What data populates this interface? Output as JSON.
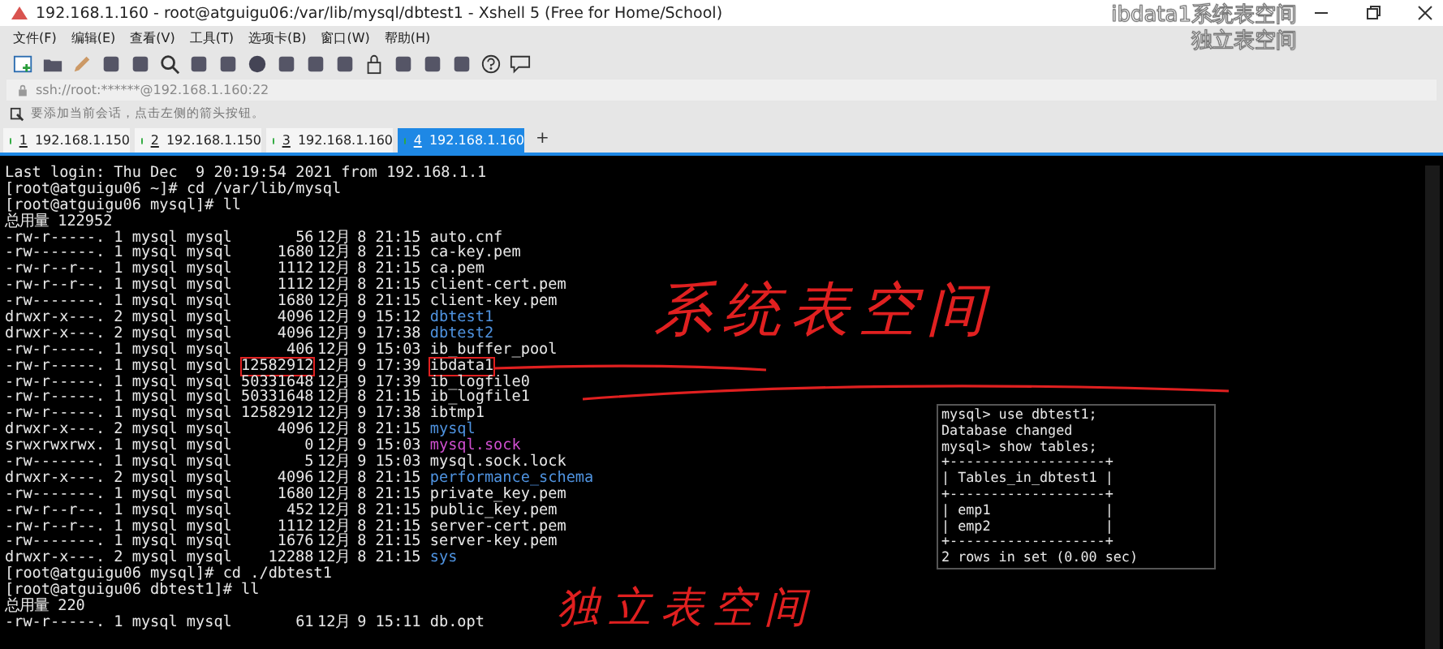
{
  "window": {
    "title": "192.168.1.160 - root@atguigu06:/var/lib/mysql/dbtest1 - Xshell 5 (Free for Home/School)"
  },
  "menu": [
    "文件(F)",
    "编辑(E)",
    "查看(V)",
    "工具(T)",
    "选项卡(B)",
    "窗口(W)",
    "帮助(H)"
  ],
  "address_bar": {
    "value": "ssh://root:******@192.168.1.160:22"
  },
  "info_bar": {
    "text": "要添加当前会话，点击左侧的箭头按钮。"
  },
  "tabs": [
    {
      "number": "1",
      "label": "192.168.1.150",
      "selected": false
    },
    {
      "number": "2",
      "label": "192.168.1.150",
      "selected": false
    },
    {
      "number": "3",
      "label": "192.168.1.160",
      "selected": false
    },
    {
      "number": "4",
      "label": "192.168.1.160",
      "selected": true
    }
  ],
  "add_tab": "+",
  "caption": [
    "ibdata1系统表空间",
    "独立表空间"
  ],
  "terminal": {
    "lines": [
      {
        "kind": "text",
        "text": "Last login: Thu Dec  9 20:19:54 2021 from 192.168.1.1"
      },
      {
        "kind": "text",
        "text": "[root@atguigu06 ~]# cd /var/lib/mysql"
      },
      {
        "kind": "text",
        "text": "[root@atguigu06 mysql]# ll"
      },
      {
        "kind": "text",
        "text": "总用量 122952"
      },
      {
        "kind": "entry",
        "perms": "-rw-r-----.",
        "links": "1",
        "owner": "mysql",
        "group": "mysql",
        "size": "56",
        "month": "12月",
        "day": "8",
        "time": "21:15",
        "name": "auto.cnf",
        "color": "#e8e8e8",
        "boxed": false
      },
      {
        "kind": "entry",
        "perms": "-rw-------.",
        "links": "1",
        "owner": "mysql",
        "group": "mysql",
        "size": "1680",
        "month": "12月",
        "day": "8",
        "time": "21:15",
        "name": "ca-key.pem",
        "color": "#e8e8e8",
        "boxed": false
      },
      {
        "kind": "entry",
        "perms": "-rw-r--r--.",
        "links": "1",
        "owner": "mysql",
        "group": "mysql",
        "size": "1112",
        "month": "12月",
        "day": "8",
        "time": "21:15",
        "name": "ca.pem",
        "color": "#e8e8e8",
        "boxed": false
      },
      {
        "kind": "entry",
        "perms": "-rw-r--r--.",
        "links": "1",
        "owner": "mysql",
        "group": "mysql",
        "size": "1112",
        "month": "12月",
        "day": "8",
        "time": "21:15",
        "name": "client-cert.pem",
        "color": "#e8e8e8",
        "boxed": false
      },
      {
        "kind": "entry",
        "perms": "-rw-------.",
        "links": "1",
        "owner": "mysql",
        "group": "mysql",
        "size": "1680",
        "month": "12月",
        "day": "8",
        "time": "21:15",
        "name": "client-key.pem",
        "color": "#e8e8e8",
        "boxed": false
      },
      {
        "kind": "entry",
        "perms": "drwxr-x---.",
        "links": "2",
        "owner": "mysql",
        "group": "mysql",
        "size": "4096",
        "month": "12月",
        "day": "9",
        "time": "15:12",
        "name": "dbtest1",
        "color": "#4f93e0",
        "boxed": false
      },
      {
        "kind": "entry",
        "perms": "drwxr-x---.",
        "links": "2",
        "owner": "mysql",
        "group": "mysql",
        "size": "4096",
        "month": "12月",
        "day": "9",
        "time": "17:38",
        "name": "dbtest2",
        "color": "#4f93e0",
        "boxed": false
      },
      {
        "kind": "entry",
        "perms": "-rw-r-----.",
        "links": "1",
        "owner": "mysql",
        "group": "mysql",
        "size": "406",
        "month": "12月",
        "day": "9",
        "time": "15:03",
        "name": "ib_buffer_pool",
        "color": "#e8e8e8",
        "boxed": false
      },
      {
        "kind": "entry",
        "perms": "-rw-r-----.",
        "links": "1",
        "owner": "mysql",
        "group": "mysql",
        "size": "12582912",
        "month": "12月",
        "day": "9",
        "time": "17:39",
        "name": "ibdata1",
        "color": "#e8e8e8",
        "boxed": true
      },
      {
        "kind": "entry",
        "perms": "-rw-r-----.",
        "links": "1",
        "owner": "mysql",
        "group": "mysql",
        "size": "50331648",
        "month": "12月",
        "day": "9",
        "time": "17:39",
        "name": "ib_logfile0",
        "color": "#e8e8e8",
        "boxed": false
      },
      {
        "kind": "entry",
        "perms": "-rw-r-----.",
        "links": "1",
        "owner": "mysql",
        "group": "mysql",
        "size": "50331648",
        "month": "12月",
        "day": "8",
        "time": "21:15",
        "name": "ib_logfile1",
        "color": "#e8e8e8",
        "boxed": false
      },
      {
        "kind": "entry",
        "perms": "-rw-r-----.",
        "links": "1",
        "owner": "mysql",
        "group": "mysql",
        "size": "12582912",
        "month": "12月",
        "day": "9",
        "time": "17:38",
        "name": "ibtmp1",
        "color": "#e8e8e8",
        "boxed": false
      },
      {
        "kind": "entry",
        "perms": "drwxr-x---.",
        "links": "2",
        "owner": "mysql",
        "group": "mysql",
        "size": "4096",
        "month": "12月",
        "day": "8",
        "time": "21:15",
        "name": "mysql",
        "color": "#4f93e0",
        "boxed": false
      },
      {
        "kind": "entry",
        "perms": "srwxrwxrwx.",
        "links": "1",
        "owner": "mysql",
        "group": "mysql",
        "size": "0",
        "month": "12月",
        "day": "9",
        "time": "15:03",
        "name": "mysql.sock",
        "color": "#d04fd0",
        "boxed": false
      },
      {
        "kind": "entry",
        "perms": "-rw-------.",
        "links": "1",
        "owner": "mysql",
        "group": "mysql",
        "size": "5",
        "month": "12月",
        "day": "9",
        "time": "15:03",
        "name": "mysql.sock.lock",
        "color": "#e8e8e8",
        "boxed": false
      },
      {
        "kind": "entry",
        "perms": "drwxr-x---.",
        "links": "2",
        "owner": "mysql",
        "group": "mysql",
        "size": "4096",
        "month": "12月",
        "day": "8",
        "time": "21:15",
        "name": "performance_schema",
        "color": "#4f93e0",
        "boxed": false
      },
      {
        "kind": "entry",
        "perms": "-rw-------.",
        "links": "1",
        "owner": "mysql",
        "group": "mysql",
        "size": "1680",
        "month": "12月",
        "day": "8",
        "time": "21:15",
        "name": "private_key.pem",
        "color": "#e8e8e8",
        "boxed": false
      },
      {
        "kind": "entry",
        "perms": "-rw-r--r--.",
        "links": "1",
        "owner": "mysql",
        "group": "mysql",
        "size": "452",
        "month": "12月",
        "day": "8",
        "time": "21:15",
        "name": "public_key.pem",
        "color": "#e8e8e8",
        "boxed": false
      },
      {
        "kind": "entry",
        "perms": "-rw-r--r--.",
        "links": "1",
        "owner": "mysql",
        "group": "mysql",
        "size": "1112",
        "month": "12月",
        "day": "8",
        "time": "21:15",
        "name": "server-cert.pem",
        "color": "#e8e8e8",
        "boxed": false
      },
      {
        "kind": "entry",
        "perms": "-rw-------.",
        "links": "1",
        "owner": "mysql",
        "group": "mysql",
        "size": "1676",
        "month": "12月",
        "day": "8",
        "time": "21:15",
        "name": "server-key.pem",
        "color": "#e8e8e8",
        "boxed": false
      },
      {
        "kind": "entry",
        "perms": "drwxr-x---.",
        "links": "2",
        "owner": "mysql",
        "group": "mysql",
        "size": "12288",
        "month": "12月",
        "day": "8",
        "time": "21:15",
        "name": "sys",
        "color": "#4f93e0",
        "boxed": false
      },
      {
        "kind": "text",
        "text": "[root@atguigu06 mysql]# cd ./dbtest1"
      },
      {
        "kind": "text",
        "text": "[root@atguigu06 dbtest1]# ll"
      },
      {
        "kind": "text",
        "text": "总用量 220"
      },
      {
        "kind": "entry",
        "perms": "-rw-r-----.",
        "links": "1",
        "owner": "mysql",
        "group": "mysql",
        "size": "61",
        "month": "12月",
        "day": "9",
        "time": "15:11",
        "name": "db.opt",
        "color": "#e8e8e8",
        "boxed": false
      }
    ]
  },
  "inset": {
    "lines": [
      "mysql> use dbtest1;",
      "Database changed",
      "mysql> show tables;",
      "+-------------------+",
      "| Tables_in_dbtest1 |",
      "+-------------------+",
      "| emp1              |",
      "| emp2              |",
      "+-------------------+",
      "2 rows in set (0.00 sec)"
    ]
  },
  "annotations": [
    "系统表空间",
    "独立表空间"
  ]
}
